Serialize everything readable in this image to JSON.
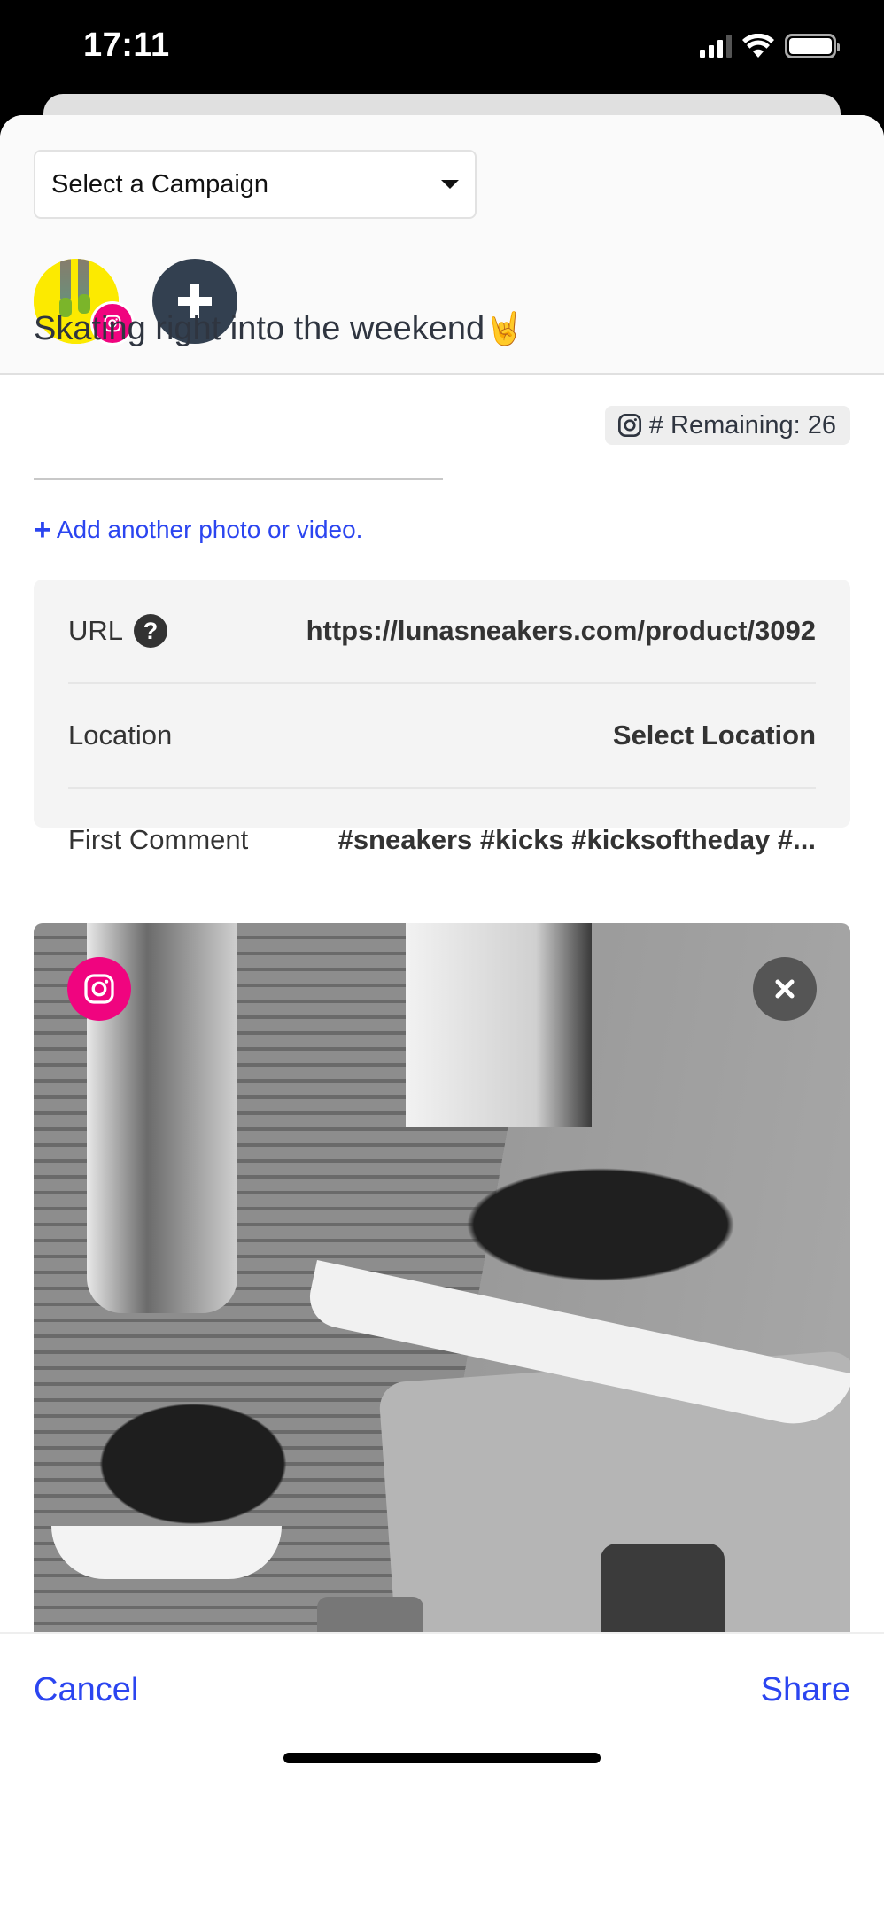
{
  "status_bar": {
    "time": "17:11",
    "icons": [
      "cellular-signal-icon",
      "wifi-icon",
      "battery-icon"
    ]
  },
  "campaign": {
    "selected": "Select a Campaign"
  },
  "accounts": [
    {
      "network": "instagram",
      "badge_icon": "instagram-icon",
      "badge_color": "#f0047f"
    }
  ],
  "add_account_icon": "plus-icon",
  "caption": {
    "text": "Skating right into the weekend",
    "emoji": "🤘"
  },
  "hashtag_counter": {
    "icon": "instagram-icon",
    "label": "# Remaining: 26"
  },
  "add_media": {
    "icon": "+",
    "label": "Add another photo or video."
  },
  "settings": {
    "url": {
      "label": "URL",
      "help_icon": "?",
      "value": "https://lunasneakers.com/product/3092"
    },
    "location": {
      "label": "Location",
      "value": "Select Location"
    },
    "first_comment": {
      "label": "First Comment",
      "value": "#sneakers #kicks #kicksoftheday #..."
    }
  },
  "media": {
    "description": "Black and white photo of sneakers on a longboard",
    "network_icon": "instagram-icon",
    "remove_icon": "close-icon"
  },
  "footer": {
    "cancel": "Cancel",
    "share": "Share"
  },
  "colors": {
    "accent": "#2b45f0",
    "instagram": "#f0047f",
    "add_button": "#334050"
  }
}
